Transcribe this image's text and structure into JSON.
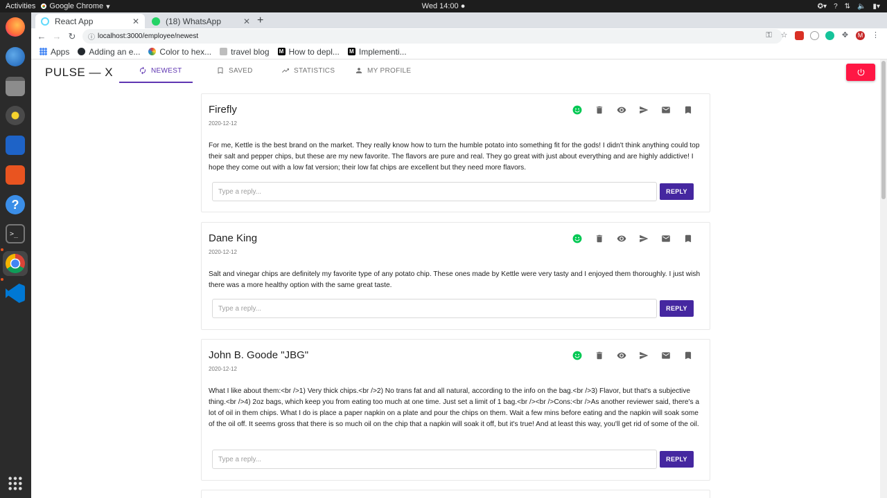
{
  "system": {
    "activities": "Activities",
    "app_menu": "Google Chrome",
    "clock": "Wed 14:00"
  },
  "browser": {
    "tabs": [
      {
        "title": "React App",
        "favicon_color": "#61dafb"
      },
      {
        "title": "(18) WhatsApp",
        "favicon_color": "#25d366"
      }
    ],
    "url": "localhost:3000/employee/newest",
    "bookmarks": [
      {
        "label": "Apps",
        "icon": "apps-grid-icon",
        "color": "#4285f4"
      },
      {
        "label": "Adding an e...",
        "icon": "github-icon",
        "color": "#24292e"
      },
      {
        "label": "Color to hex...",
        "icon": "color-wheel-icon",
        "color": "#e53935"
      },
      {
        "label": "travel blog",
        "icon": "blog-icon",
        "color": "#9e9e9e"
      },
      {
        "label": "How to depl...",
        "icon": "medium-icon",
        "color": "#000000"
      },
      {
        "label": "Implementi...",
        "icon": "medium-icon",
        "color": "#000000"
      }
    ]
  },
  "app": {
    "brand": "PULSE — X",
    "nav": [
      {
        "label": "NEWEST",
        "icon": "refresh-icon",
        "active": true
      },
      {
        "label": "SAVED",
        "icon": "bookmark-outline-icon",
        "active": false
      },
      {
        "label": "STATISTICS",
        "icon": "trending-up-icon",
        "active": false
      },
      {
        "label": "MY PROFILE",
        "icon": "person-icon",
        "active": false
      }
    ],
    "colors": {
      "primary": "#5e35b1",
      "reply_button": "#4527a0",
      "logout": "#ff1744",
      "positive_sentiment": "#00c853"
    },
    "reply_placeholder": "Type a reply...",
    "reply_label": "REPLY",
    "reviews": [
      {
        "name": "Firefly",
        "date": "2020-12-12",
        "text": "For me, Kettle is the best brand on the market. They really know how to turn the humble potato into something fit for the gods! I didn't think anything could top their salt and pepper chips, but these are my new favorite. The flavors are pure and real. They go great with just about everything and are highly addictive! I hope they come out with a low fat version; their low fat chips are excellent but they need more flavors."
      },
      {
        "name": "Dane King",
        "date": "2020-12-12",
        "text": "Salt and vinegar chips are definitely my favorite type of any potato chip. These ones made by Kettle were very tasty and I enjoyed them thoroughly. I just wish there was a more healthy option with the same great taste."
      },
      {
        "name": "John B. Goode \"JBG\"",
        "date": "2020-12-12",
        "text": "What I like about them:<br />1) Very thick chips.<br />2) No trans fat and all natural, according to the info on the bag.<br />3) Flavor, but that's a subjective thing.<br />4) 2oz bags, which keep you from eating too much at one time. Just set a limit of 1 bag.<br /><br />Cons:<br />As another reviewer said, there's a lot of oil in them chips. What I do is place a paper napkin on a plate and pour the chips on them. Wait a few mins before eating and the napkin will soak some of the oil off. It seems gross that there is so much oil on the chip that a napkin will soak it off, but it's true! And at least this way, you'll get rid of some of the oil."
      }
    ]
  }
}
